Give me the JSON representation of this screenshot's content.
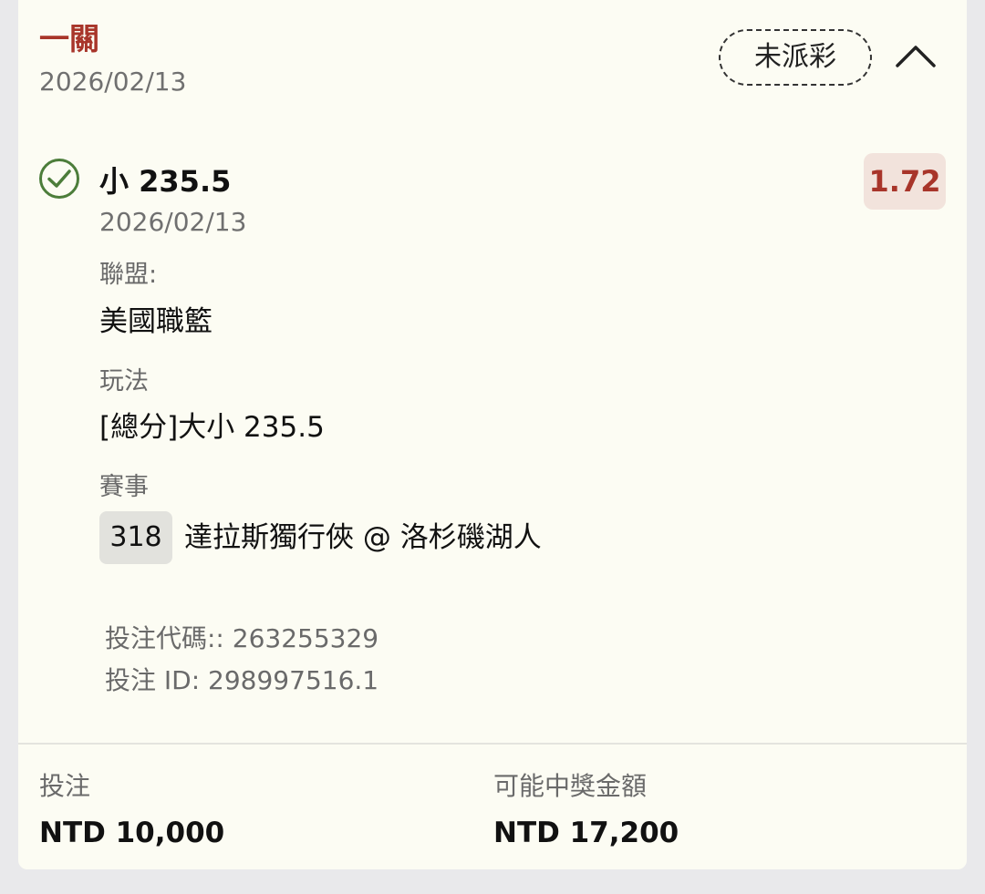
{
  "header": {
    "title": "一關",
    "date": "2026/02/13",
    "status": "未派彩",
    "collapse_icon": "chevron-up-icon"
  },
  "selection": {
    "check_icon": "check-circle-icon",
    "title": "小 235.5",
    "date": "2026/02/13",
    "odds": "1.72",
    "league_label": "聯盟:",
    "league_value": "美國職籃",
    "market_label": "玩法",
    "market_value": "[總分]大小 235.5",
    "event_label": "賽事",
    "event_number": "318",
    "event_name": "達拉斯獨行俠 @ 洛杉磯湖人"
  },
  "codes": {
    "bet_code": "投注代碼:: 263255329",
    "bet_id": "投注 ID: 298997516.1"
  },
  "footer": {
    "stake_label": "投注",
    "stake_value": "NTD 10,000",
    "payout_label": "可能中獎金額",
    "payout_value": "NTD 17,200"
  },
  "colors": {
    "accent": "#a8352a",
    "success": "#4c7d3a",
    "card_bg": "#fcfcf3",
    "page_bg": "#e9e9eb"
  }
}
